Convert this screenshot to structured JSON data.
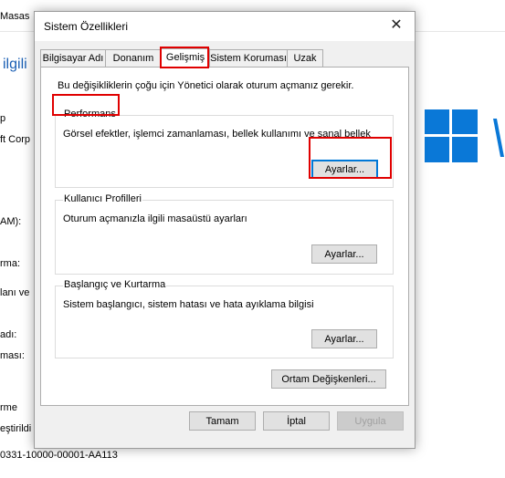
{
  "background": {
    "fragments": [
      "Masas",
      "ilgili",
      "p",
      "ft Corp",
      "AM):",
      "rma:",
      "lanı ve",
      "adı:",
      "ması:",
      "rme",
      "eştirildi",
      "0331-10000-00001-AA113"
    ]
  },
  "dialog": {
    "title": "Sistem Özellikleri",
    "close_glyph": "✕",
    "tabs": [
      {
        "label": "Bilgisayar Adı"
      },
      {
        "label": "Donanım"
      },
      {
        "label": "Gelişmiş"
      },
      {
        "label": "Sistem Koruması"
      },
      {
        "label": "Uzak"
      }
    ],
    "active_tab": "Gelişmiş",
    "admin_note": "Bu değişikliklerin çoğu için Yönetici olarak oturum açmanız gerekir.",
    "performance": {
      "title": "Performans",
      "description": "Görsel efektler, işlemci zamanlaması, bellek kullanımı ve sanal bellek",
      "button": "Ayarlar..."
    },
    "user_profiles": {
      "title": "Kullanıcı Profilleri",
      "description": "Oturum açmanızla ilgili masaüstü ayarları",
      "button": "Ayarlar..."
    },
    "startup_recovery": {
      "title": "Başlangıç ve Kurtarma",
      "description": "Sistem başlangıcı, sistem hatası ve hata ayıklama bilgisi",
      "button": "Ayarlar..."
    },
    "env_button": "Ortam Değişkenleri...",
    "ok_button": "Tamam",
    "cancel_button": "İptal",
    "apply_button": "Uygula"
  },
  "colors": {
    "highlight": "#e00000",
    "windows_logo": "#0a78d7",
    "focus": "#0078d7"
  }
}
